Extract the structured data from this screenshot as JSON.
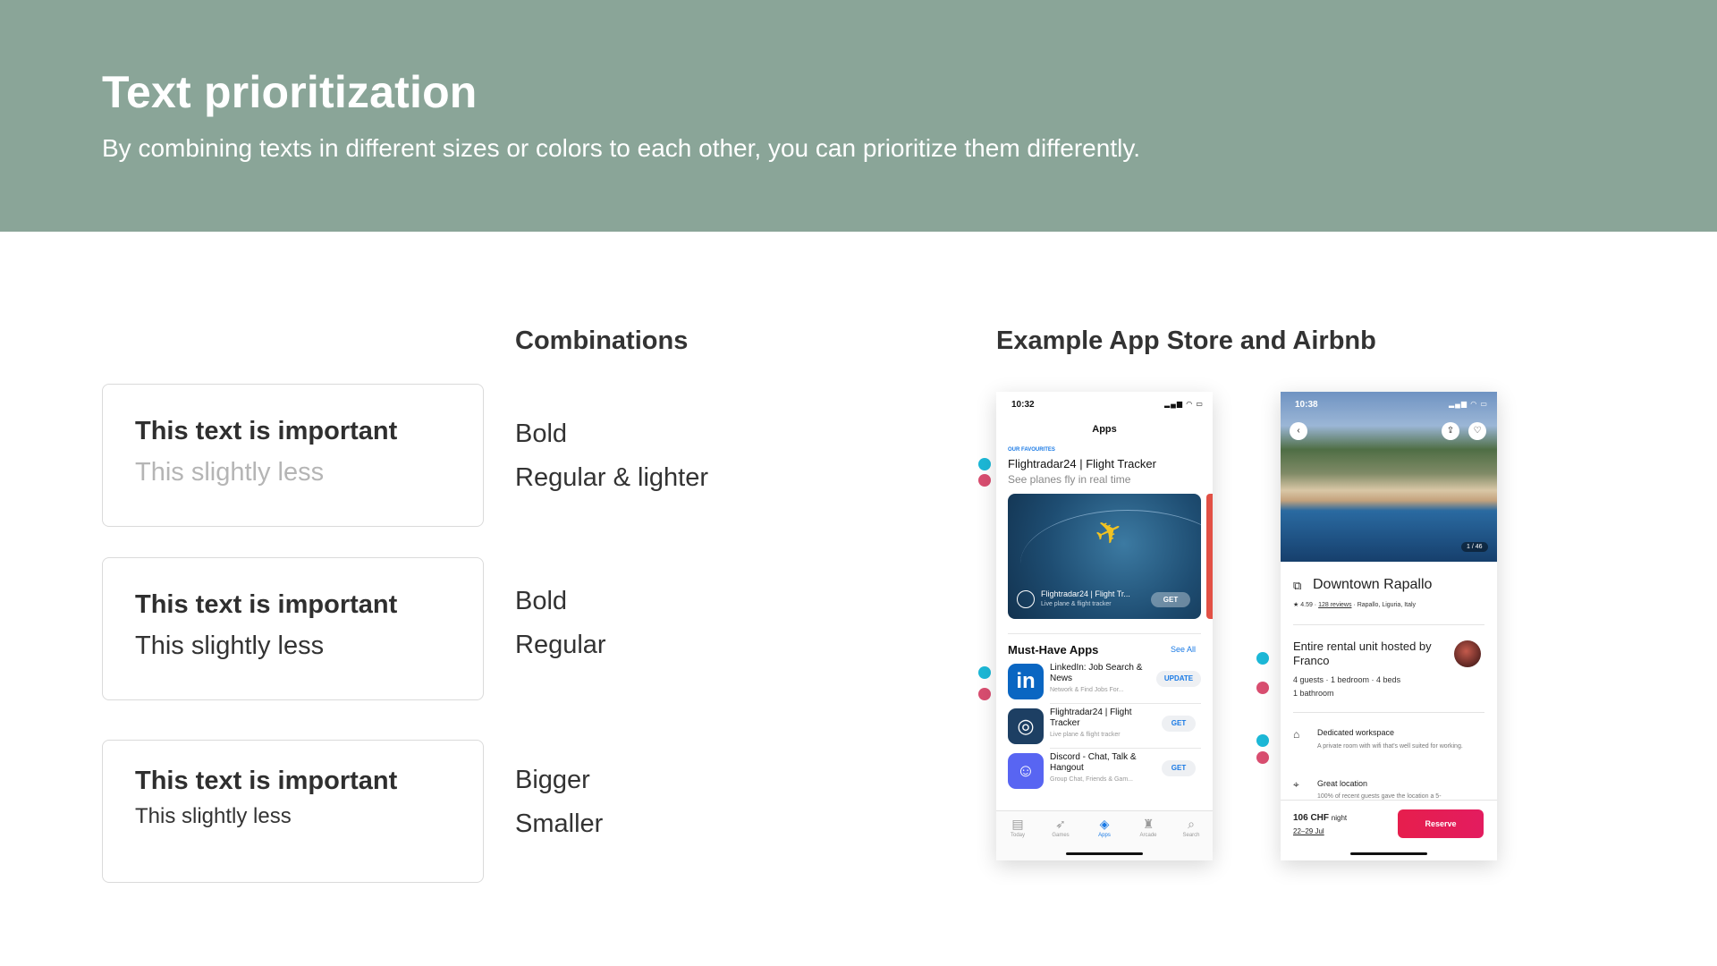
{
  "header": {
    "title": "Text prioritization",
    "subtitle": "By combining texts in different sizes or colors to each other, you can prioritize them differently."
  },
  "sections": {
    "combinations_title": "Combinations",
    "example_title": "Example App Store and Airbnb"
  },
  "cards": [
    {
      "important": "This text is important",
      "less": "This slightly less",
      "combo_primary": "Bold",
      "combo_secondary": "Regular & lighter"
    },
    {
      "important": "This text is important",
      "less": "This slightly less",
      "combo_primary": "Bold",
      "combo_secondary": "Regular"
    },
    {
      "important": "This text is important",
      "less": "This slightly less",
      "combo_primary": "Bigger",
      "combo_secondary": "Smaller"
    }
  ],
  "colors": {
    "header_bg": "#8aa598",
    "primary_marker": "#1cb8d7",
    "secondary_marker": "#d94e70",
    "lighter_text": "#b5b5b5"
  },
  "app_store": {
    "time": "10:32",
    "title": "Apps",
    "featured_tag": "OUR FAVOURITES",
    "featured_title": "Flightradar24 | Flight Tracker",
    "featured_subtitle": "See planes fly in real time",
    "banner_title": "Flightradar24 | Flight Tr...",
    "banner_subtitle": "Live plane & flight tracker",
    "banner_button": "GET",
    "section_title": "Must-Have Apps",
    "see_all": "See All",
    "apps": [
      {
        "name": "LinkedIn: Job Search & News",
        "subtitle": "Network & Find Jobs For...",
        "button": "UPDATE",
        "icon": "linkedin-icon"
      },
      {
        "name": "Flightradar24 | Flight Tracker",
        "subtitle": "Live plane & flight tracker",
        "button": "GET",
        "icon": "radar-icon"
      },
      {
        "name": "Discord - Chat, Talk & Hangout",
        "subtitle": "Group Chat, Friends & Gam...",
        "button": "GET",
        "icon": "discord-icon"
      }
    ],
    "tabs": [
      {
        "label": "Today",
        "icon": "today-icon"
      },
      {
        "label": "Games",
        "icon": "rocket-icon"
      },
      {
        "label": "Apps",
        "icon": "layers-icon"
      },
      {
        "label": "Arcade",
        "icon": "joystick-icon"
      },
      {
        "label": "Search",
        "icon": "search-icon"
      }
    ]
  },
  "airbnb": {
    "time": "10:38",
    "photo_counter": "1 / 46",
    "title": "Downtown Rapallo",
    "rating": "4.59",
    "reviews": "128 reviews",
    "location": "Rapallo, Liguria, Italy",
    "unit_title": "Entire rental unit hosted by Franco",
    "guests_line": "4 guests · 1 bedroom · 4 beds",
    "bath_line": "1 bathroom",
    "feature1_title": "Dedicated workspace",
    "feature1_sub": "A private room with wifi that's well suited for working.",
    "feature2_title": "Great location",
    "feature2_sub": "100% of recent guests gave the location a 5-",
    "price": "106 CHF",
    "price_unit": "night",
    "dates": "22–29 Jul",
    "reserve": "Reserve"
  }
}
